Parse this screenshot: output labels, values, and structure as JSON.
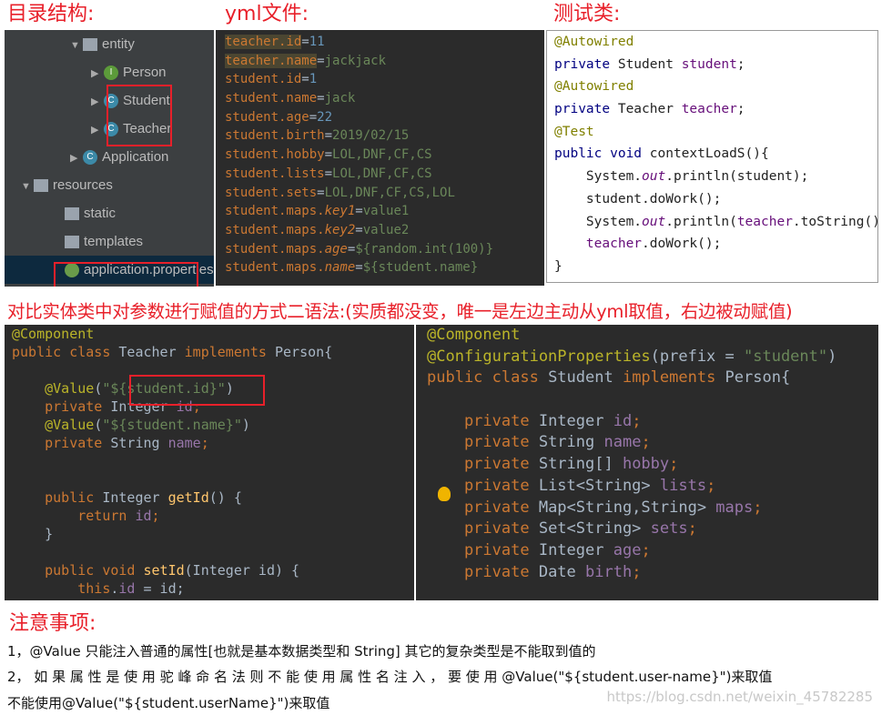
{
  "headings": {
    "tree": "目录结构:",
    "yml": "yml文件:",
    "test": "测试类:",
    "compare": "对比实体类中对参数进行赋值的方式二语法:(实质都没变，唯一是左边主动从yml取值，右边被动赋值)",
    "notes": "注意事项:"
  },
  "tree": [
    {
      "label": "entity",
      "kind": "folder",
      "arrow": "▼"
    },
    {
      "label": "Person",
      "kind": "interface",
      "arrow": "▶",
      "badge": "I"
    },
    {
      "label": "Student",
      "kind": "class",
      "arrow": "▶",
      "badge": "C"
    },
    {
      "label": "Teacher",
      "kind": "class",
      "arrow": "▶",
      "badge": "C"
    },
    {
      "label": "Application",
      "kind": "app",
      "arrow": "▶",
      "badge": "C"
    },
    {
      "label": "resources",
      "kind": "folder",
      "arrow": "▼"
    },
    {
      "label": "static",
      "kind": "folder",
      "arrow": ""
    },
    {
      "label": "templates",
      "kind": "folder",
      "arrow": ""
    },
    {
      "label": "application.properties",
      "kind": "props",
      "arrow": "",
      "selected": true
    }
  ],
  "yml": [
    [
      [
        "teacher.id",
        "k hl"
      ],
      [
        "=",
        "t"
      ],
      [
        "11",
        "n"
      ]
    ],
    [
      [
        "teacher.name",
        "k hl"
      ],
      [
        "=",
        "t"
      ],
      [
        "jackjack",
        "v"
      ]
    ],
    [
      [
        "student.id",
        "k"
      ],
      [
        "=",
        "t"
      ],
      [
        "1",
        "n"
      ]
    ],
    [
      [
        "student.name",
        "k"
      ],
      [
        "=",
        "t"
      ],
      [
        "jack",
        "v"
      ]
    ],
    [
      [
        "student.age",
        "k"
      ],
      [
        "=",
        "t"
      ],
      [
        "22",
        "n"
      ]
    ],
    [
      [
        "student.birth",
        "k"
      ],
      [
        "=",
        "t"
      ],
      [
        "2019/02/15",
        "v"
      ]
    ],
    [
      [
        "student.hobby",
        "k"
      ],
      [
        "=",
        "t"
      ],
      [
        "LOL,DNF,CF,CS",
        "v"
      ]
    ],
    [
      [
        "student.lists",
        "k"
      ],
      [
        "=",
        "t"
      ],
      [
        "LOL,DNF,CF,CS",
        "v"
      ]
    ],
    [
      [
        "student.sets",
        "k"
      ],
      [
        "=",
        "t"
      ],
      [
        "LOL,DNF,CF,CS,LOL",
        "v"
      ]
    ],
    [
      [
        "student.maps.",
        "k"
      ],
      [
        "key1",
        "i"
      ],
      [
        "=",
        "t"
      ],
      [
        "value1",
        "v"
      ]
    ],
    [
      [
        "student.maps.",
        "k"
      ],
      [
        "key2",
        "i"
      ],
      [
        "=",
        "t"
      ],
      [
        "value2",
        "v"
      ]
    ],
    [
      [
        "student.maps.",
        "k"
      ],
      [
        "age",
        "i"
      ],
      [
        "=",
        "t"
      ],
      [
        "${random.int(100)}",
        "v"
      ]
    ],
    [
      [
        "student.maps.",
        "k"
      ],
      [
        "name",
        "i"
      ],
      [
        "=",
        "t"
      ],
      [
        "${student.name}",
        "v"
      ]
    ]
  ],
  "test": [
    [
      [
        "@Autowired",
        "a"
      ]
    ],
    [
      [
        "private ",
        "k"
      ],
      [
        "Student ",
        "t"
      ],
      [
        "student",
        "f"
      ],
      [
        ";",
        "t"
      ]
    ],
    [
      [
        "@Autowired",
        "a"
      ]
    ],
    [
      [
        "private ",
        "k"
      ],
      [
        "Teacher ",
        "t"
      ],
      [
        "teacher",
        "f"
      ],
      [
        ";",
        "t"
      ]
    ],
    [
      [
        "@Test",
        "a"
      ]
    ],
    [
      [
        "public void ",
        "k"
      ],
      [
        "contextLoadS",
        "m"
      ],
      [
        "(){",
        "t"
      ]
    ],
    [
      [
        "    System.",
        "t"
      ],
      [
        "out",
        "fi"
      ],
      [
        ".println(student);",
        "t"
      ]
    ],
    [
      [
        "    student.doWork();",
        "t"
      ]
    ],
    [
      [
        "    System.",
        "t"
      ],
      [
        "out",
        "fi"
      ],
      [
        ".println(",
        "t"
      ],
      [
        "teacher",
        "f"
      ],
      [
        ".toString());",
        "t"
      ]
    ],
    [
      [
        "    ",
        "t"
      ],
      [
        "teacher",
        "f"
      ],
      [
        ".doWork();",
        "t"
      ]
    ],
    [
      [
        "}",
        "t"
      ]
    ]
  ],
  "teacher_class": [
    [
      [
        "@Component",
        "a"
      ]
    ],
    [
      [
        "public class ",
        "k"
      ],
      [
        "Teacher ",
        "t"
      ],
      [
        "implements ",
        "k"
      ],
      [
        "Person{",
        "t"
      ]
    ],
    [
      [
        "",
        "t"
      ]
    ],
    [
      [
        "    @Value",
        "a"
      ],
      [
        "(",
        "t"
      ],
      [
        "\"${student.id}\"",
        "v"
      ],
      [
        ")",
        "t"
      ]
    ],
    [
      [
        "    private ",
        "k"
      ],
      [
        "Integer ",
        "t"
      ],
      [
        "id",
        "f"
      ],
      [
        ";",
        "k"
      ]
    ],
    [
      [
        "    @Value",
        "a"
      ],
      [
        "(",
        "t"
      ],
      [
        "\"${student.name}\"",
        "v"
      ],
      [
        ")",
        "t"
      ]
    ],
    [
      [
        "    private ",
        "k"
      ],
      [
        "String ",
        "t"
      ],
      [
        "name",
        "f"
      ],
      [
        ";",
        "k"
      ]
    ],
    [
      [
        "",
        "t"
      ]
    ],
    [
      [
        "",
        "t"
      ]
    ],
    [
      [
        "    public ",
        "k"
      ],
      [
        "Integer ",
        "t"
      ],
      [
        "getId",
        "m"
      ],
      [
        "() {",
        "t"
      ]
    ],
    [
      [
        "        return ",
        "k"
      ],
      [
        "id",
        "f"
      ],
      [
        ";",
        "k"
      ]
    ],
    [
      [
        "    }",
        "t"
      ]
    ],
    [
      [
        "",
        "t"
      ]
    ],
    [
      [
        "    public void ",
        "k"
      ],
      [
        "setId",
        "m"
      ],
      [
        "(Integer id) {",
        "t"
      ]
    ],
    [
      [
        "        this",
        "k"
      ],
      [
        ".",
        "t"
      ],
      [
        "id",
        "f"
      ],
      [
        " = id;",
        "t"
      ]
    ],
    [
      [
        "    }",
        "t"
      ]
    ]
  ],
  "student_class": [
    [
      [
        "@Component",
        "a"
      ]
    ],
    [
      [
        "@ConfigurationProperties",
        "a"
      ],
      [
        "(prefix = ",
        "t"
      ],
      [
        "\"student\"",
        "v"
      ],
      [
        ")",
        "t"
      ]
    ],
    [
      [
        "public class ",
        "k"
      ],
      [
        "Student ",
        "t"
      ],
      [
        "implements ",
        "k"
      ],
      [
        "Person{",
        "t"
      ]
    ],
    [
      [
        "",
        "t"
      ]
    ],
    [
      [
        "    private ",
        "k"
      ],
      [
        "Integer ",
        "t"
      ],
      [
        "id",
        "f"
      ],
      [
        ";",
        "k"
      ]
    ],
    [
      [
        "    private ",
        "k"
      ],
      [
        "String ",
        "t"
      ],
      [
        "name",
        "f"
      ],
      [
        ";",
        "k"
      ]
    ],
    [
      [
        "    private ",
        "k"
      ],
      [
        "String[] ",
        "t"
      ],
      [
        "hobby",
        "f"
      ],
      [
        ";",
        "k"
      ]
    ],
    [
      [
        "    private ",
        "k"
      ],
      [
        "List<String> ",
        "t"
      ],
      [
        "lists",
        "f"
      ],
      [
        ";",
        "k"
      ]
    ],
    [
      [
        "    private ",
        "k"
      ],
      [
        "Map<String,String> ",
        "t"
      ],
      [
        "maps",
        "f"
      ],
      [
        ";",
        "k"
      ]
    ],
    [
      [
        "    private ",
        "k"
      ],
      [
        "Set<String> ",
        "t"
      ],
      [
        "sets",
        "f"
      ],
      [
        ";",
        "k"
      ]
    ],
    [
      [
        "    private ",
        "k"
      ],
      [
        "Integer ",
        "t"
      ],
      [
        "age",
        "f"
      ],
      [
        ";",
        "k"
      ]
    ],
    [
      [
        "    private ",
        "k"
      ],
      [
        "Date ",
        "t"
      ],
      [
        "birth",
        "f"
      ],
      [
        ";",
        "k"
      ]
    ]
  ],
  "notes": {
    "line1": "1，@Value 只能注入普通的属性[也就是基本数据类型和 String]  其它的复杂类型是不能取到值的",
    "line2": "2， 如 果 属 性 是 使 用 驼 峰 命 名 法 则 不 能 使 用 属 性 名 注 入 ， 要 使 用 @Value(\"${student.user-name}\")来取值",
    "line3": "不能使用@Value(\"${student.userName}\")来取值"
  },
  "watermark": "https://blog.csdn.net/weixin_45782285",
  "colors": {
    "accent_red": "#e8202a",
    "editor_bg": "#2b2b2b",
    "keyword": "#cc7832",
    "string": "#6a8759",
    "annotation": "#bbb529",
    "field": "#9876aa"
  }
}
